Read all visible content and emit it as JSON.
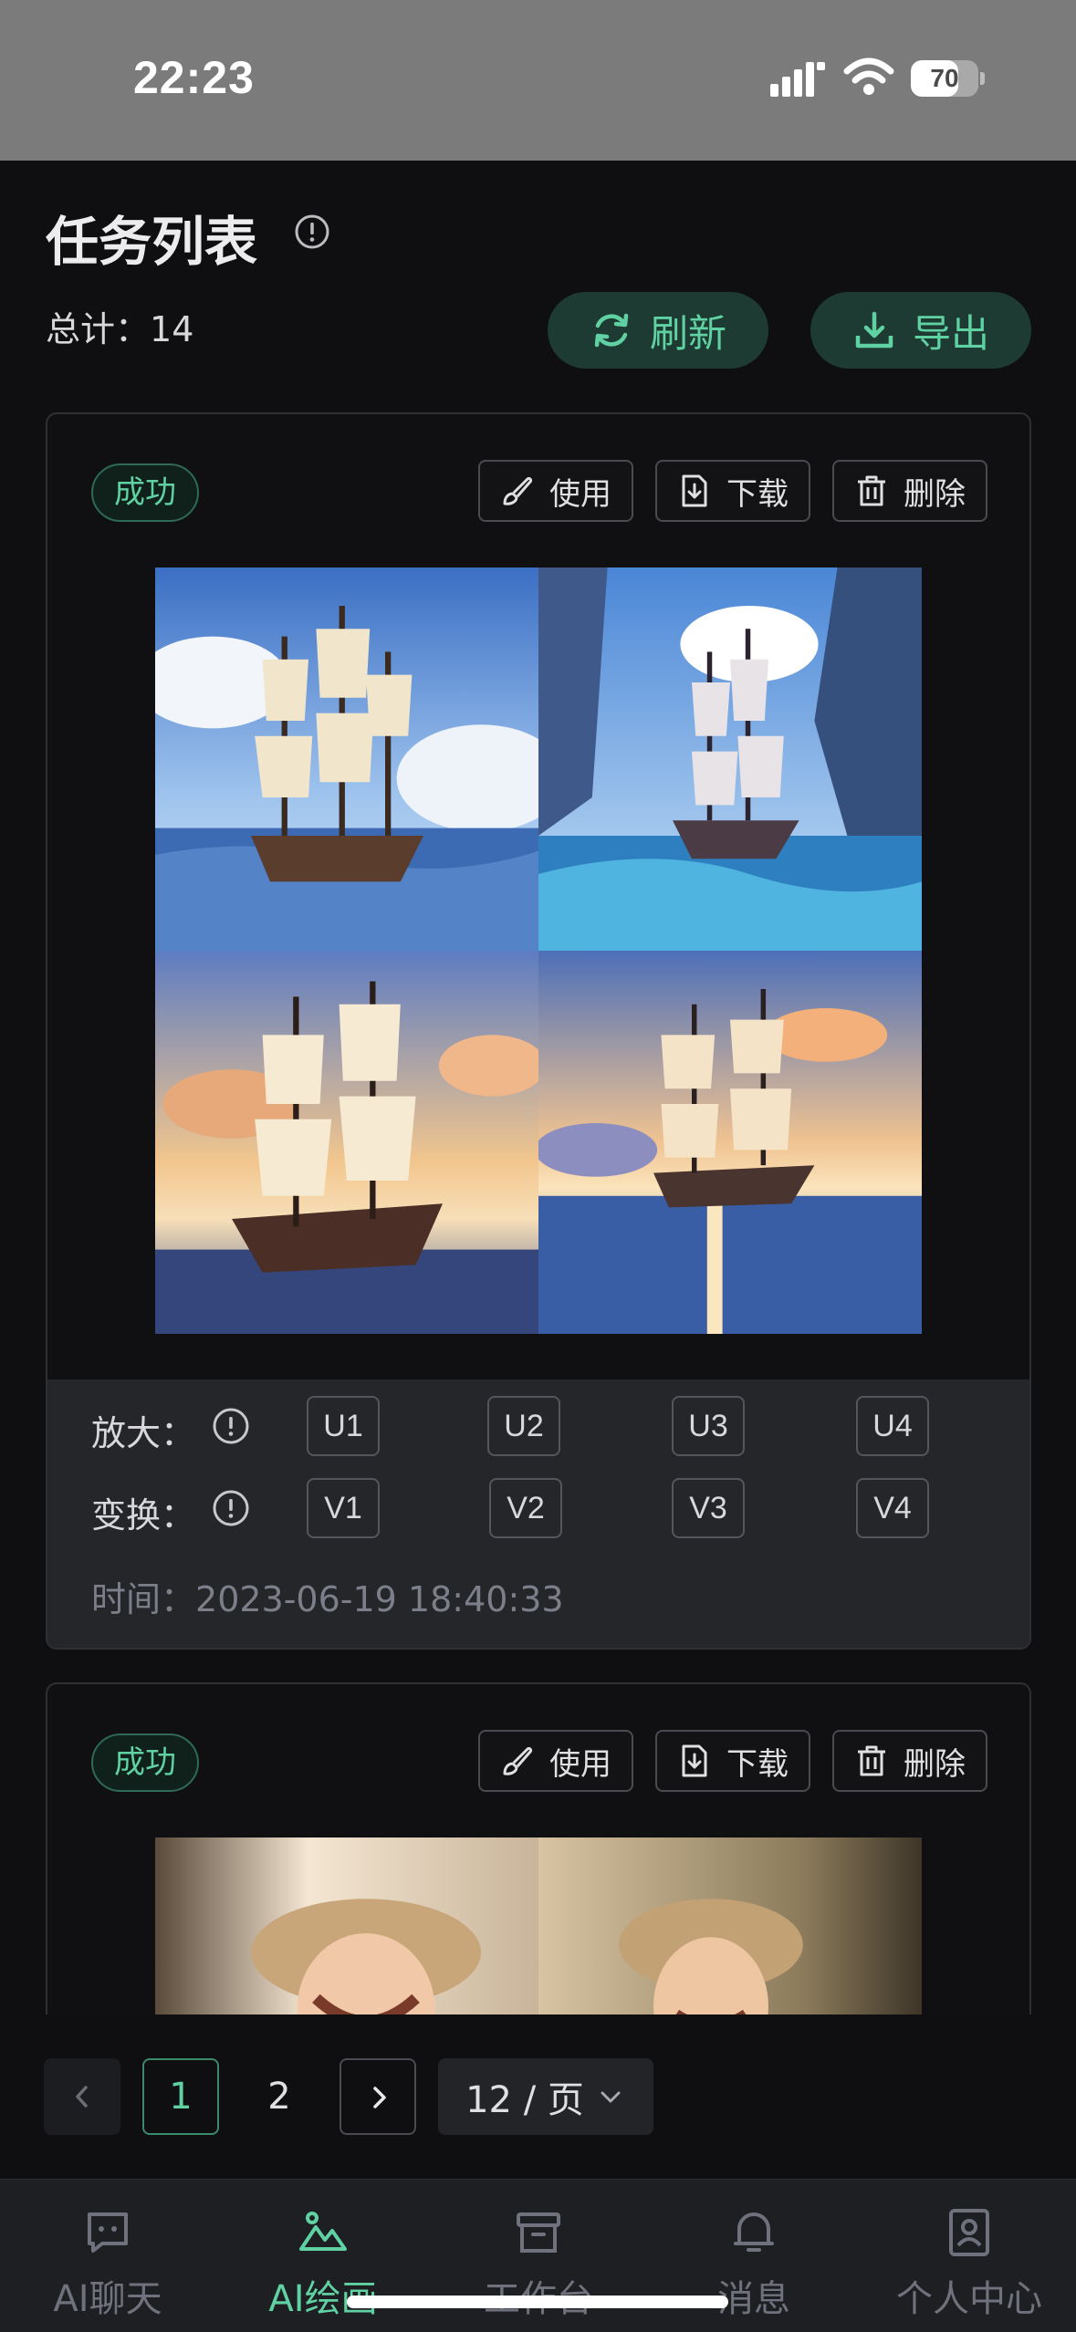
{
  "status_bar": {
    "time": "22:23",
    "battery": "70",
    "battery_level": 0.7
  },
  "header": {
    "title": "任务列表",
    "total_label": "总计：",
    "total_value": "14",
    "refresh_label": "刷新",
    "export_label": "导出"
  },
  "colors": {
    "accent": "#5fd1a2",
    "accent_bg": "#1d3a33",
    "background": "#0f0f12",
    "card_bottom": "#25262a"
  },
  "tasks": [
    {
      "status": "成功",
      "actions": {
        "use": "使用",
        "download": "下载",
        "delete": "删除"
      },
      "image_desc": "four sailing ship illustrations in a 2x2 grid",
      "upscale_label": "放大：",
      "variation_label": "变换：",
      "upscale_buttons": [
        "U1",
        "U2",
        "U3",
        "U4"
      ],
      "variation_buttons": [
        "V1",
        "V2",
        "V3",
        "V4"
      ],
      "time_label": "时间：",
      "time_value": "2023-06-19 18:40:33"
    },
    {
      "status": "成功",
      "actions": {
        "use": "使用",
        "download": "下载",
        "delete": "删除"
      }
    }
  ],
  "pagination": {
    "current": "1",
    "next_page": "2",
    "page_size": "12 / 页"
  },
  "tabbar": {
    "items": [
      {
        "label": "AI聊天",
        "icon": "chat-icon"
      },
      {
        "label": "AI绘画",
        "icon": "painting-icon",
        "active": true
      },
      {
        "label": "工作台",
        "icon": "box-icon"
      },
      {
        "label": "消息",
        "icon": "bell-icon"
      },
      {
        "label": "个人中心",
        "icon": "profile-icon"
      }
    ]
  }
}
